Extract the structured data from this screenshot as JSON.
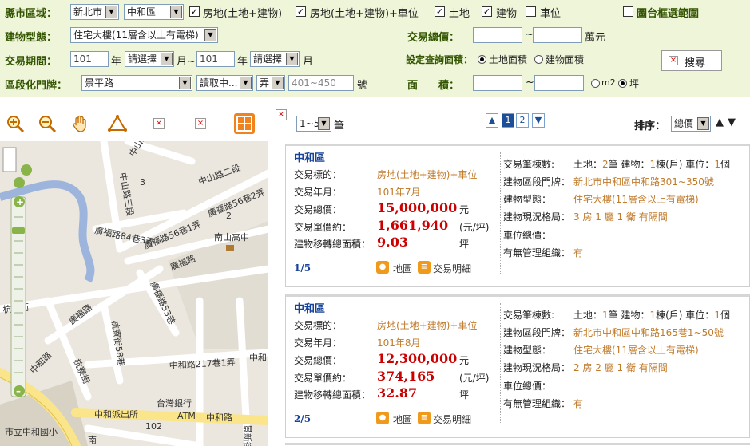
{
  "search": {
    "region_label": "縣市區域：",
    "city": "新北市",
    "district": "中和區",
    "checks": [
      {
        "label": "房地(土地+建物)",
        "checked": true
      },
      {
        "label": "房地(土地+建物)+車位",
        "checked": true
      },
      {
        "label": "土地",
        "checked": true
      },
      {
        "label": "建物",
        "checked": true
      },
      {
        "label": "車位",
        "checked": false
      }
    ],
    "map_select_label": "圖台框選範圍",
    "map_select_checked": false,
    "building_type_label": "建物型態：",
    "building_type": "住宅大樓(11層含以上有電梯)",
    "total_price_label": "交易總價：",
    "price_sep": "~",
    "price_unit": "萬元",
    "period_label": "交易期間：",
    "year_from": "101",
    "year_unit": "年",
    "month_from": "請選擇",
    "month_sep": "月~",
    "year_to": "101",
    "month_to": "請選擇",
    "month_unit": "月",
    "area_type_label": "設定查詢面積：",
    "area_land": "土地面積",
    "area_building": "建物面積",
    "area_land_selected": true,
    "search_button": "搜尋",
    "address_label": "區段化門牌：",
    "road": "景平路",
    "lane_select": "讀取中...",
    "alley_select": "弄",
    "number_range": "401~450",
    "number_unit": "號",
    "area_label": "面　　積：",
    "area_sep": "~",
    "area_unit_m2": "m2",
    "area_unit_ping": "坪",
    "ping_selected": true
  },
  "map_tools": {
    "zoom_in": "zoom-in-icon",
    "zoom_out": "zoom-out-icon",
    "pan": "hand-icon",
    "polygon": "polygon-icon",
    "grid": "grid-icon"
  },
  "map": {
    "labels": [
      "中山路二段",
      "中山路三段",
      "中山路二段",
      "廣福路84巷3弄",
      "廣福路56巷2弄",
      "廣福路56巷1弄",
      "廣福路",
      "南山高中",
      "廣福路53巷",
      "杭寮街",
      "廣福路",
      "杭寮街58巷",
      "杭寮街",
      "中和路217巷1弄",
      "中和路",
      "台灣銀行",
      "ATM",
      "中和派出所",
      "中和路",
      "102",
      "市立中和國小",
      "南",
      "景新街",
      "2",
      "3",
      "中山路二段",
      "中和"
    ]
  },
  "results_toolbar": {
    "per_page": "1~5",
    "per_page_unit": "筆",
    "pages": [
      "1",
      "2"
    ],
    "current_page": "1",
    "sort_label": "排序：",
    "sort_value": "總價"
  },
  "records": [
    {
      "district": "中和區",
      "target_label": "交易標的：",
      "target": "房地(土地+建物)+車位",
      "date_label": "交易年月：",
      "date": "101年7月",
      "total_label": "交易總價：",
      "total": "15,000,000",
      "total_unit": "元",
      "unit_price_label": "交易單價約：",
      "unit_price": "1,661,940",
      "unit_price_unit": "(元/坪)",
      "area_label": "建物移轉總面積：",
      "area": "9.03",
      "area_unit": "坪",
      "index": "1/5",
      "map_link": "地圖",
      "detail_link": "交易明細",
      "count_label": "交易筆棟數:",
      "count_land": "土地：",
      "count_land_n": "2",
      "count_land_u": "筆 建物：",
      "count_bldg_n": "1",
      "count_bldg_u": "棟(戶) 車位：",
      "count_park_n": "1",
      "count_park_u": "個",
      "address_label": "建物區段門牌：",
      "address": "新北市中和區中和路301~350號",
      "type_label": "建物型態：",
      "type": "住宅大樓(11層含以上有電梯)",
      "layout_label": "建物現況格局：",
      "layout": "3 房 1 廳 1 衛 有隔間",
      "parking_label": "車位總價：",
      "parking": "",
      "mgmt_label": "有無管理組織：",
      "mgmt": "有"
    },
    {
      "district": "中和區",
      "target_label": "交易標的：",
      "target": "房地(土地+建物)+車位",
      "date_label": "交易年月：",
      "date": "101年8月",
      "total_label": "交易總價：",
      "total": "12,300,000",
      "total_unit": "元",
      "unit_price_label": "交易單價約：",
      "unit_price": "374,165",
      "unit_price_unit": "(元/坪)",
      "area_label": "建物移轉總面積：",
      "area": "32.87",
      "area_unit": "坪",
      "index": "2/5",
      "map_link": "地圖",
      "detail_link": "交易明細",
      "count_label": "交易筆棟數:",
      "count_land": "土地：",
      "count_land_n": "1",
      "count_land_u": "筆 建物：",
      "count_bldg_n": "1",
      "count_bldg_u": "棟(戶) 車位：",
      "count_park_n": "1",
      "count_park_u": "個",
      "address_label": "建物區段門牌：",
      "address": "新北市中和區中和路165巷1~50號",
      "type_label": "建物型態：",
      "type": "住宅大樓(11層含以上有電梯)",
      "layout_label": "建物現況格局：",
      "layout": "2 房 2 廳 1 衛 有隔間",
      "parking_label": "車位總價：",
      "parking": "",
      "mgmt_label": "有無管理組織：",
      "mgmt": "有"
    }
  ],
  "colors": {
    "panel_bg": "#eef5d8",
    "label_green": "#335500",
    "price_red": "#cc0000",
    "value_orange": "#c07b2b",
    "link_blue": "#17439a"
  }
}
